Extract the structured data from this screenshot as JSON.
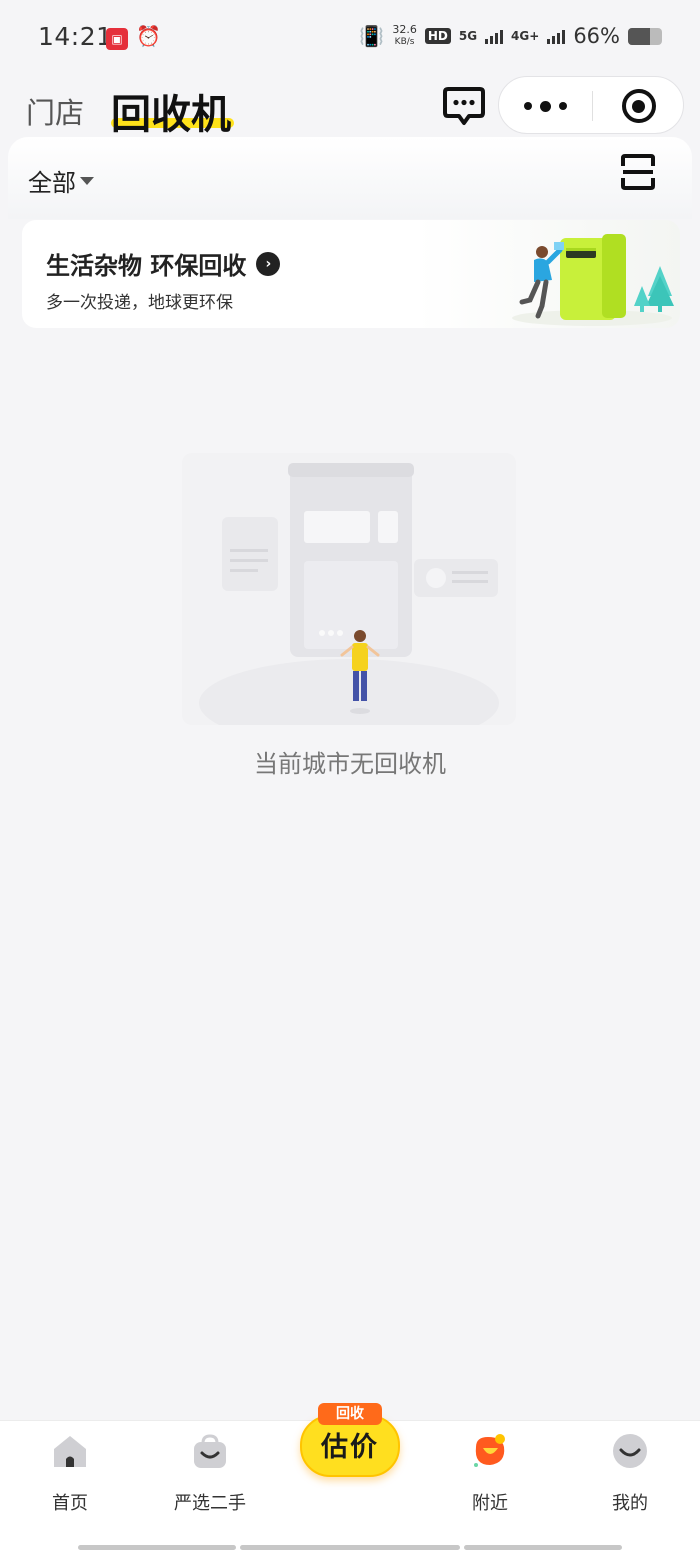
{
  "status_bar": {
    "time": "14:21",
    "speed_value": "32.6",
    "speed_unit": "KB/s",
    "hd_label": "HD",
    "network_1": "5G",
    "network_2": "4G+",
    "battery_percent": "66%",
    "battery_level": 0.66
  },
  "header": {
    "tab_store": "门店",
    "tab_recycle": "回收机"
  },
  "filter": {
    "all_label": "全部"
  },
  "banner": {
    "title": "生活杂物 环保回收",
    "subtitle": "多一次投递，地球更环保"
  },
  "empty_state": {
    "message": "当前城市无回收机"
  },
  "bottom_nav": {
    "home": "首页",
    "second_hand": "严选二手",
    "center_badge": "回收",
    "center_label": "估价",
    "nearby": "附近",
    "mine": "我的"
  },
  "colors": {
    "accent_yellow": "#ffe21a",
    "badge_orange": "#ff6a1a",
    "recycle_green": "#c8f03a"
  }
}
